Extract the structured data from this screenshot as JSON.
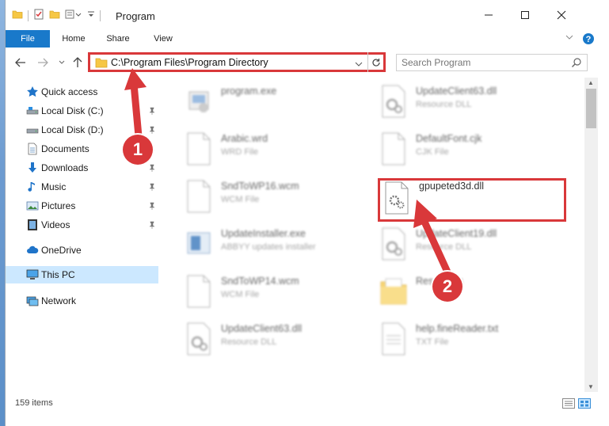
{
  "window": {
    "title": "Program",
    "controls": [
      "minimize",
      "maximize",
      "close"
    ]
  },
  "ribbon": {
    "tabs": [
      {
        "label": "File",
        "active": true
      },
      {
        "label": "Home"
      },
      {
        "label": "Share"
      },
      {
        "label": "View"
      }
    ]
  },
  "address": {
    "path": "C:\\Program Files\\Program Directory"
  },
  "search": {
    "placeholder": "Search Program"
  },
  "nav": {
    "items": [
      {
        "label": "Quick access",
        "icon": "star-icon",
        "pinned": false
      },
      {
        "label": "Local Disk (C:)",
        "icon": "drive-icon",
        "pinned": true
      },
      {
        "label": "Local Disk (D:)",
        "icon": "drive-icon",
        "pinned": true
      },
      {
        "label": "Documents",
        "icon": "document-icon",
        "pinned": true
      },
      {
        "label": "Downloads",
        "icon": "download-icon",
        "pinned": true
      },
      {
        "label": "Music",
        "icon": "music-icon",
        "pinned": true
      },
      {
        "label": "Pictures",
        "icon": "pictures-icon",
        "pinned": true
      },
      {
        "label": "Videos",
        "icon": "videos-icon",
        "pinned": true
      },
      {
        "label": "OneDrive",
        "icon": "cloud-icon",
        "pinned": false
      },
      {
        "label": "This PC",
        "icon": "computer-icon",
        "pinned": false,
        "selected": true
      },
      {
        "label": "Network",
        "icon": "network-icon",
        "pinned": false
      }
    ]
  },
  "files": [
    {
      "name": "program.exe",
      "type": "",
      "icon": "exe-icon",
      "blurred": true
    },
    {
      "name": "UpdateClient63.dll",
      "type": "Resource DLL",
      "icon": "dll-icon",
      "blurred": true
    },
    {
      "name": "Arabic.wrd",
      "type": "WRD File",
      "icon": "blank-file-icon",
      "blurred": true
    },
    {
      "name": "DefaultFont.cjk",
      "type": "CJK File",
      "icon": "blank-file-icon",
      "blurred": true
    },
    {
      "name": "SndToWP16.wcm",
      "type": "WCM File",
      "icon": "blank-file-icon",
      "blurred": true
    },
    {
      "name": "gpupeted3d.dll",
      "type": "",
      "icon": "dll-icon",
      "blurred": false,
      "highlighted": true
    },
    {
      "name": "UpdateInstaller.exe",
      "type": "ABBYY updates installer",
      "icon": "installer-icon",
      "blurred": true
    },
    {
      "name": "UpdateClient19.dll",
      "type": "Resource DLL",
      "icon": "dll-icon",
      "blurred": true
    },
    {
      "name": "SndToWP14.wcm",
      "type": "WCM File",
      "icon": "blank-file-icon",
      "blurred": true
    },
    {
      "name": "Resources",
      "type": "",
      "icon": "folder-icon",
      "blurred": true
    },
    {
      "name": "UpdateClient63.dll",
      "type": "Resource DLL",
      "icon": "dll-icon",
      "blurred": true
    },
    {
      "name": "help.fineReader.txt",
      "type": "TXT File",
      "icon": "text-file-icon",
      "blurred": true
    }
  ],
  "status": {
    "item_count": "159 items"
  },
  "annotations": [
    {
      "number": "1",
      "color": "#d9383a"
    },
    {
      "number": "2",
      "color": "#d9383a"
    }
  ],
  "colors": {
    "accent": "#1979ca",
    "annotation_red": "#d9383a",
    "selected_bg": "#cce8ff",
    "folder_yellow": "#f6c744"
  }
}
